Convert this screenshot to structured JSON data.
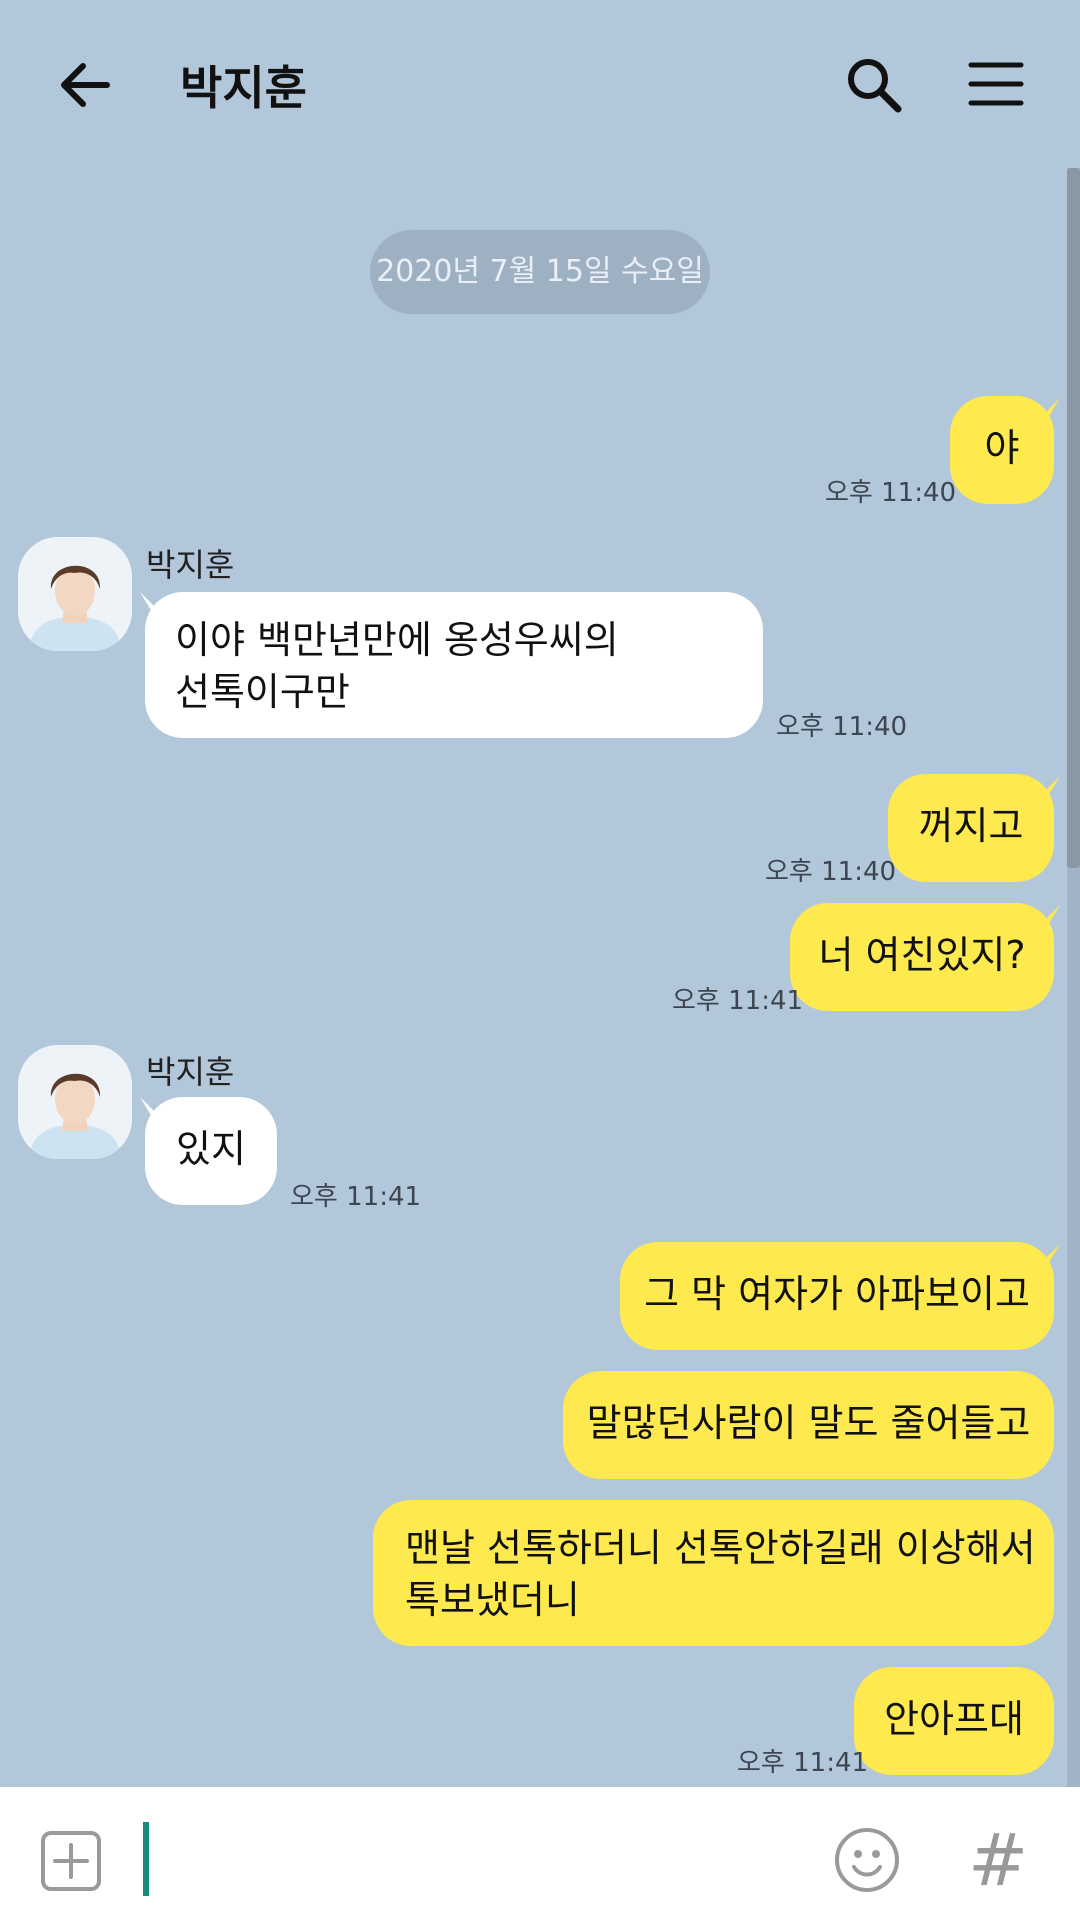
{
  "header": {
    "title": "박지훈",
    "back_icon": "arrow-left-icon",
    "search_icon": "search-icon",
    "menu_icon": "menu-icon"
  },
  "date_divider": "2020년 7월 15일 수요일",
  "contact_name": "박지훈",
  "messages": [
    {
      "from": "me",
      "text": "야",
      "time": "오후 11:40"
    },
    {
      "from": "other",
      "sender": "박지훈",
      "line1": "이야 백만년만에 옹성우씨의",
      "line2": "선톡이구만",
      "time": "오후 11:40"
    },
    {
      "from": "me",
      "text": "꺼지고",
      "time": "오후 11:40"
    },
    {
      "from": "me",
      "text": "너 여친있지?",
      "time": "오후 11:41"
    },
    {
      "from": "other",
      "sender": "박지훈",
      "text": "있지",
      "time": "오후 11:41"
    },
    {
      "from": "me",
      "text": "그 막 여자가 아파보이고"
    },
    {
      "from": "me",
      "text": "말많던사람이 말도 줄어들고"
    },
    {
      "from": "me",
      "line1": "맨날 선톡하더니 선톡안하길래 이상해서",
      "line2": "톡보냈더니"
    },
    {
      "from": "me",
      "text": "안아프대",
      "time": "오후 11:41"
    }
  ],
  "input": {
    "plus_icon": "plus-icon",
    "emoji_icon": "emoji-icon",
    "hash_label": "#"
  },
  "colors": {
    "background": "#b2c7da",
    "my_bubble": "#fee94e",
    "other_bubble": "#ffffff",
    "cursor": "#1a8a7a"
  }
}
